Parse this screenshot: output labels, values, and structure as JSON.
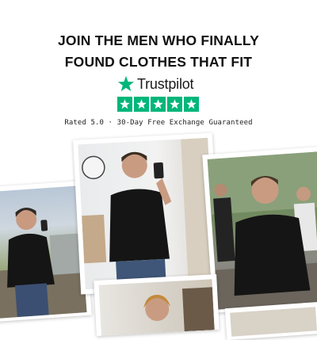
{
  "headline": {
    "line1": "JOIN THE MEN WHO FINALLY",
    "line2": "FOUND CLOTHES THAT FIT"
  },
  "trustpilot": {
    "brand_name": "Trustpilot",
    "logo_icon": "star-icon",
    "star_count": 5,
    "rating_value": 5,
    "star_color": "#00b67a"
  },
  "rating_line": "Rated 5.0 · 30-Day Free Exchange Guaranteed",
  "photos": [
    {
      "id": "left",
      "description_icon": "photo"
    },
    {
      "id": "center",
      "description_icon": "photo"
    },
    {
      "id": "right",
      "description_icon": "photo"
    },
    {
      "id": "bottom",
      "description_icon": "photo"
    }
  ],
  "colors": {
    "text": "#111111",
    "trustpilot_green": "#00b67a",
    "shirt": "#151515"
  }
}
